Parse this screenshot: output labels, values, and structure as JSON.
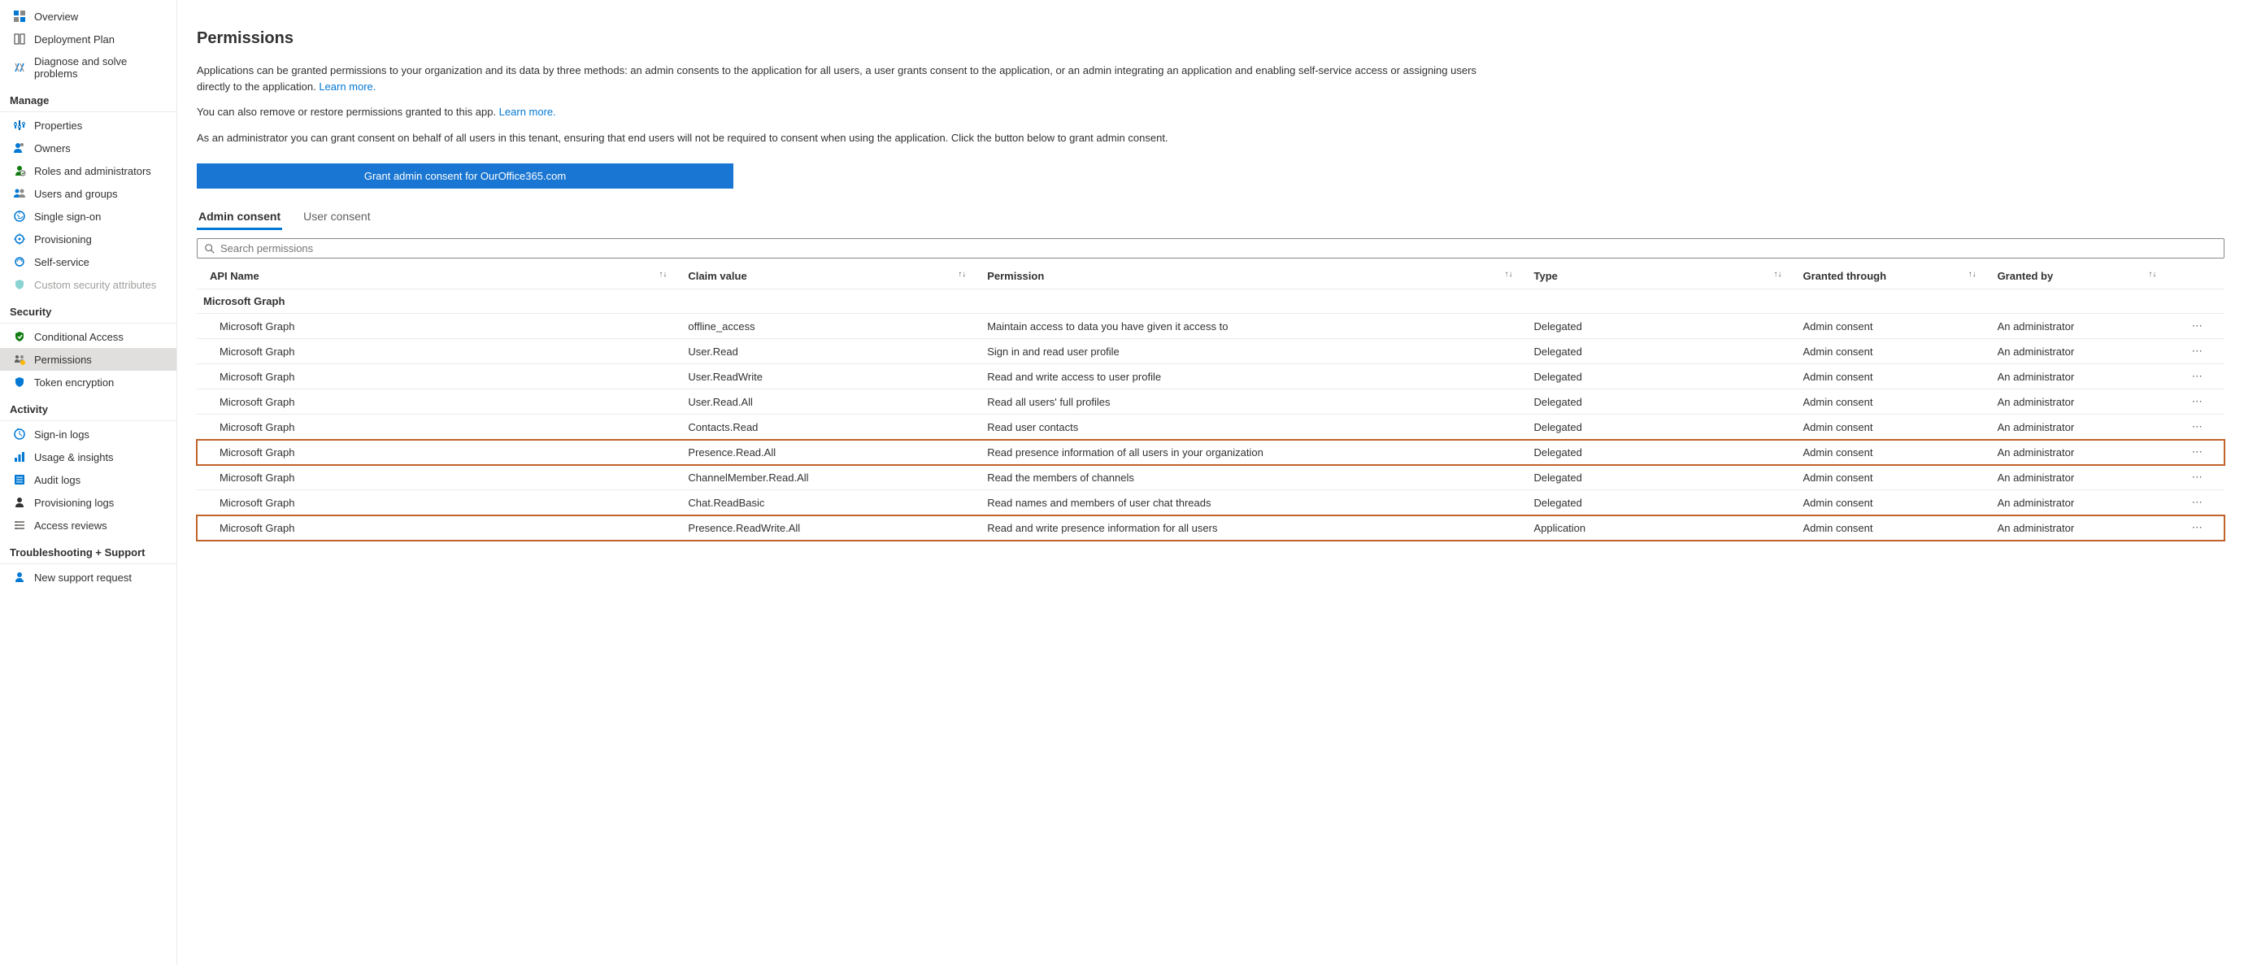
{
  "sidebar": {
    "top_items": [
      {
        "label": "Overview",
        "icon": "overview"
      },
      {
        "label": "Deployment Plan",
        "icon": "deployment"
      },
      {
        "label": "Diagnose and solve problems",
        "icon": "diagnose"
      }
    ],
    "groups": [
      {
        "header": "Manage",
        "items": [
          {
            "label": "Properties",
            "icon": "properties"
          },
          {
            "label": "Owners",
            "icon": "owners"
          },
          {
            "label": "Roles and administrators",
            "icon": "roles"
          },
          {
            "label": "Users and groups",
            "icon": "users"
          },
          {
            "label": "Single sign-on",
            "icon": "sso"
          },
          {
            "label": "Provisioning",
            "icon": "provisioning"
          },
          {
            "label": "Self-service",
            "icon": "selfservice"
          },
          {
            "label": "Custom security attributes",
            "icon": "customsec",
            "disabled": true
          }
        ]
      },
      {
        "header": "Security",
        "items": [
          {
            "label": "Conditional Access",
            "icon": "conditional"
          },
          {
            "label": "Permissions",
            "icon": "permissions",
            "active": true
          },
          {
            "label": "Token encryption",
            "icon": "token"
          }
        ]
      },
      {
        "header": "Activity",
        "items": [
          {
            "label": "Sign-in logs",
            "icon": "signin"
          },
          {
            "label": "Usage & insights",
            "icon": "usage"
          },
          {
            "label": "Audit logs",
            "icon": "audit"
          },
          {
            "label": "Provisioning logs",
            "icon": "provlogs"
          },
          {
            "label": "Access reviews",
            "icon": "accessrev"
          }
        ]
      },
      {
        "header": "Troubleshooting + Support",
        "items": [
          {
            "label": "New support request",
            "icon": "support"
          }
        ]
      }
    ]
  },
  "page": {
    "title": "Permissions",
    "intro1_pre": "Applications can be granted permissions to your organization and its data by three methods: an admin consents to the application for all users, a user grants consent to the application, or an admin integrating an application and enabling self-service access or assigning users directly to the application. ",
    "intro1_link": "Learn more.",
    "intro2_pre": "You can also remove or restore permissions granted to this app. ",
    "intro2_link": "Learn more.",
    "intro3": "As an administrator you can grant consent on behalf of all users in this tenant, ensuring that end users will not be required to consent when using the application. Click the button below to grant admin consent.",
    "consent_button": "Grant admin consent for OurOffice365.com",
    "tabs": [
      {
        "label": "Admin consent",
        "active": true
      },
      {
        "label": "User consent"
      }
    ],
    "search_placeholder": "Search permissions",
    "columns": [
      "API Name",
      "Claim value",
      "Permission",
      "Type",
      "Granted through",
      "Granted by"
    ],
    "group_label": "Microsoft Graph",
    "rows": [
      {
        "api": "Microsoft Graph",
        "claim": "offline_access",
        "perm": "Maintain access to data you have given it access to",
        "type": "Delegated",
        "through": "Admin consent",
        "by": "An administrator"
      },
      {
        "api": "Microsoft Graph",
        "claim": "User.Read",
        "perm": "Sign in and read user profile",
        "type": "Delegated",
        "through": "Admin consent",
        "by": "An administrator"
      },
      {
        "api": "Microsoft Graph",
        "claim": "User.ReadWrite",
        "perm": "Read and write access to user profile",
        "type": "Delegated",
        "through": "Admin consent",
        "by": "An administrator"
      },
      {
        "api": "Microsoft Graph",
        "claim": "User.Read.All",
        "perm": "Read all users' full profiles",
        "type": "Delegated",
        "through": "Admin consent",
        "by": "An administrator"
      },
      {
        "api": "Microsoft Graph",
        "claim": "Contacts.Read",
        "perm": "Read user contacts",
        "type": "Delegated",
        "through": "Admin consent",
        "by": "An administrator"
      },
      {
        "api": "Microsoft Graph",
        "claim": "Presence.Read.All",
        "perm": "Read presence information of all users in your organization",
        "type": "Delegated",
        "through": "Admin consent",
        "by": "An administrator",
        "highlight": true
      },
      {
        "api": "Microsoft Graph",
        "claim": "ChannelMember.Read.All",
        "perm": "Read the members of channels",
        "type": "Delegated",
        "through": "Admin consent",
        "by": "An administrator"
      },
      {
        "api": "Microsoft Graph",
        "claim": "Chat.ReadBasic",
        "perm": "Read names and members of user chat threads",
        "type": "Delegated",
        "through": "Admin consent",
        "by": "An administrator"
      },
      {
        "api": "Microsoft Graph",
        "claim": "Presence.ReadWrite.All",
        "perm": "Read and write presence information for all users",
        "type": "Application",
        "through": "Admin consent",
        "by": "An administrator",
        "highlight": true
      }
    ]
  },
  "icons": {
    "overview": "#0078d4",
    "deployment": "#323130",
    "diagnose": "#0078d4",
    "properties": "#0078d4",
    "owners": "#0078d4",
    "roles": "#107c10",
    "users": "#0078d4",
    "sso": "#0078d4",
    "provisioning": "#0078d4",
    "selfservice": "#0078d4",
    "customsec": "#8ad3d3",
    "conditional": "#107c10",
    "permissions": "#323130",
    "token": "#0078d4",
    "signin": "#0078d4",
    "usage": "#0078d4",
    "audit": "#0078d4",
    "provlogs": "#323130",
    "accessrev": "#605e5c",
    "support": "#0078d4"
  }
}
